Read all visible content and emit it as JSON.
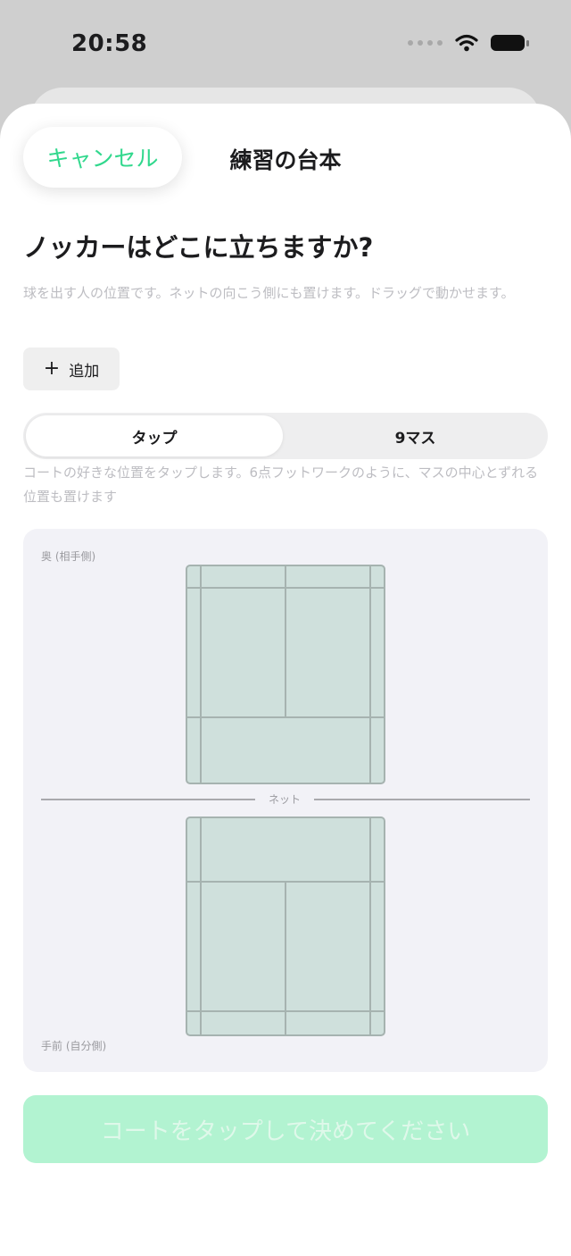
{
  "status": {
    "time": "20:58",
    "icons": [
      "signal-dots-icon",
      "wifi-icon",
      "battery-icon"
    ]
  },
  "header": {
    "cancel_label": "キャンセル",
    "title": "練習の台本"
  },
  "question": "ノッカーはどこに立ちますか?",
  "description": "球を出す人の位置です。ネットの向こう側にも置けます。ドラッグで動かせます。",
  "add_button": {
    "icon": "plus-icon",
    "label": "追加"
  },
  "mode_segment": {
    "options": [
      "タップ",
      "9マス"
    ],
    "selected": "タップ"
  },
  "hint": "コートの好きな位置をタップします。6点フットワークのように、マスの中心とずれる位置も置けます",
  "court": {
    "back_label": "奥 (相手側)",
    "front_label": "手前 (自分側)",
    "net_label": "ネット"
  },
  "submit_label": "コートをタップして決めてください",
  "colors": {
    "accent": "#31d88d",
    "court_fill": "#cfe0dc",
    "court_line": "#a6b3b0",
    "panel_bg": "#f2f2f7",
    "submit_bg": "#b2f3d1"
  }
}
